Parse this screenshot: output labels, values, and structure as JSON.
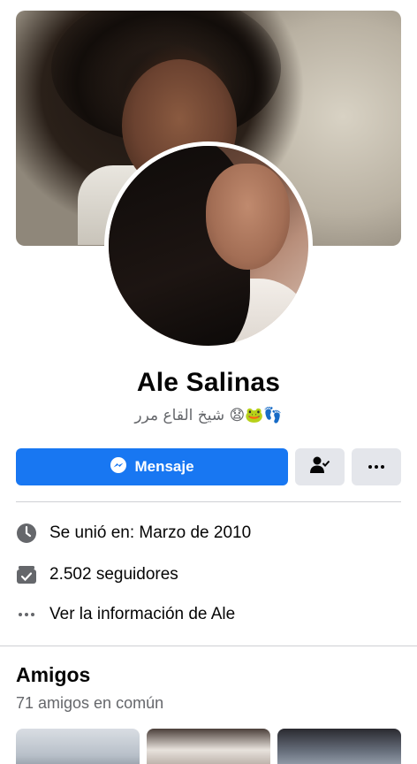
{
  "profile": {
    "name": "Ale Salinas",
    "bio": "شيخ القاع مرر 😧🐸👣"
  },
  "actions": {
    "message_label": "Mensaje",
    "friend_icon": "friend-check-icon",
    "more_icon": "more-icon"
  },
  "info": {
    "joined": "Se unió en: Marzo de 2010",
    "followers": "2.502 seguidores",
    "see_info": "Ver la información de Ale"
  },
  "friends": {
    "title": "Amigos",
    "mutual": "71 amigos en común"
  },
  "colors": {
    "primary": "#1877f2",
    "secondary_button": "#e4e6eb",
    "secondary_text": "#65676b"
  }
}
